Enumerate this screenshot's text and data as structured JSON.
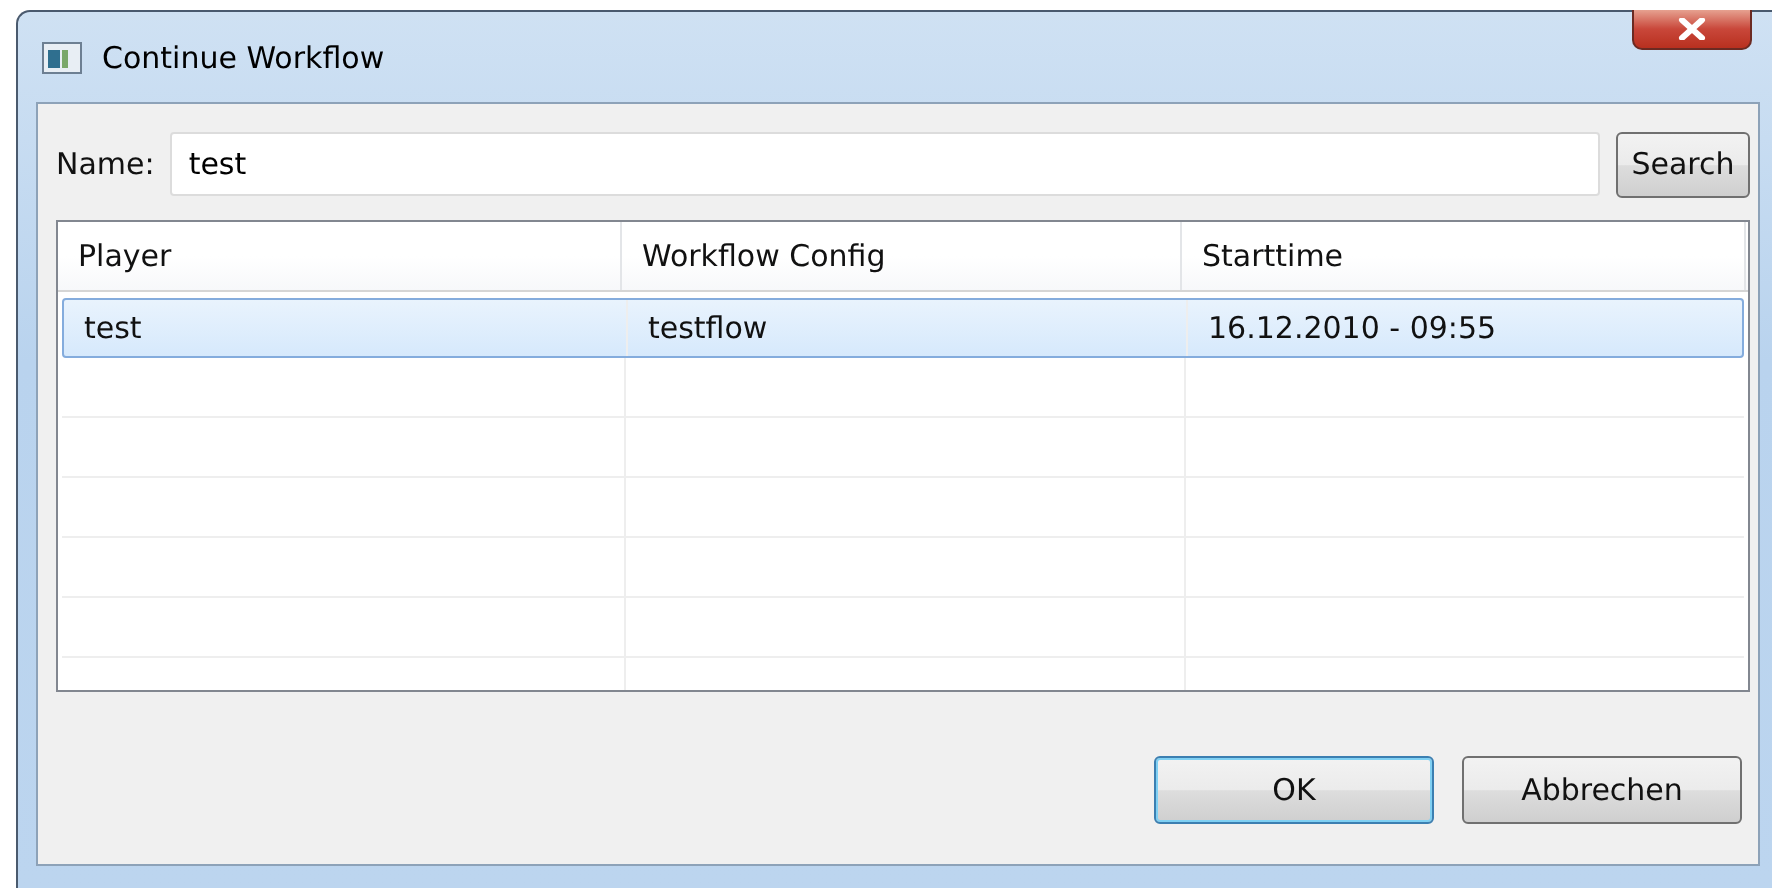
{
  "window": {
    "title": "Continue Workflow"
  },
  "search": {
    "label": "Name:",
    "value": "test",
    "button": "Search"
  },
  "table": {
    "columns": [
      "Player",
      "Workflow Config",
      "Starttime"
    ],
    "rows": [
      {
        "cells": [
          "test",
          "testflow",
          "16.12.2010 - 09:55"
        ],
        "selected": true
      }
    ]
  },
  "buttons": [
    {
      "label": "OK",
      "default": true
    },
    {
      "label": "Abbrechen",
      "default": false
    }
  ]
}
